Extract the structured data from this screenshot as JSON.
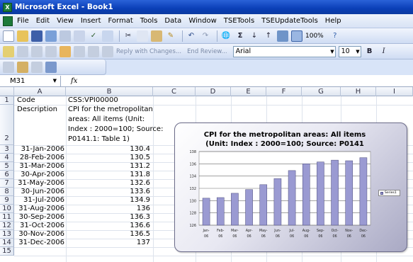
{
  "window": {
    "title": "Microsoft Excel - Book1"
  },
  "menu": [
    "File",
    "Edit",
    "View",
    "Insert",
    "Format",
    "Tools",
    "Data",
    "Window",
    "TSETools",
    "TSEUpdateTools",
    "Help"
  ],
  "toolbar": {
    "zoom": "100%",
    "font_name": "Arial",
    "font_size": "10",
    "bold_label": "B",
    "italic_label": "I",
    "reply_text": "Reply with Changes...",
    "end_review_text": "End Review...",
    "sigma_label": "Σ"
  },
  "formula_bar": {
    "name_box": "M31",
    "fx_label": "fx",
    "content": ""
  },
  "columns": [
    "A",
    "B",
    "C",
    "D",
    "E",
    "F",
    "G",
    "H",
    "I"
  ],
  "rows": [
    "1",
    "2",
    "3",
    "4",
    "5",
    "6",
    "7",
    "8",
    "9",
    "10",
    "11",
    "12",
    "13",
    "14",
    "15"
  ],
  "cells": {
    "a1": "Code",
    "b1": "CSS:VPI00000",
    "a2": "Description",
    "b2_lines": [
      "CPI for the metropolitan",
      "areas: All items (Unit:",
      "Index : 2000=100; Source:",
      "P0141.1: Table 1)"
    ],
    "dates": [
      "31-Jan-2006",
      "28-Feb-2006",
      "31-Mar-2006",
      "30-Apr-2006",
      "31-May-2006",
      "30-Jun-2006",
      "31-Jul-2006",
      "31-Aug-2006",
      "30-Sep-2006",
      "31-Oct-2006",
      "30-Nov-2006",
      "31-Dec-2006"
    ],
    "values": [
      "130.4",
      "130.5",
      "131.2",
      "131.8",
      "132.6",
      "133.6",
      "134.9",
      "136",
      "136.3",
      "136.6",
      "136.5",
      "137"
    ]
  },
  "chart_data": {
    "type": "bar",
    "title": "CPI for the metropolitan areas: All items (Unit: Index : 2000=100; Source: P0141",
    "categories": [
      "Jan-06",
      "Feb-06",
      "Mar-06",
      "Apr-06",
      "May-06",
      "Jun-06",
      "Jul-06",
      "Aug-06",
      "Sep-06",
      "Oct-06",
      "Nov-06",
      "Dec-06"
    ],
    "values": [
      130.4,
      130.5,
      131.2,
      131.8,
      132.6,
      133.6,
      134.9,
      136,
      136.3,
      136.6,
      136.5,
      137
    ],
    "ylim": [
      126,
      138
    ],
    "yticks": [
      "126",
      "128",
      "130",
      "132",
      "134",
      "136",
      "138"
    ],
    "legend": "Series1",
    "legend_position": "right",
    "grid": true,
    "bar_color": "#9a9ad2"
  }
}
